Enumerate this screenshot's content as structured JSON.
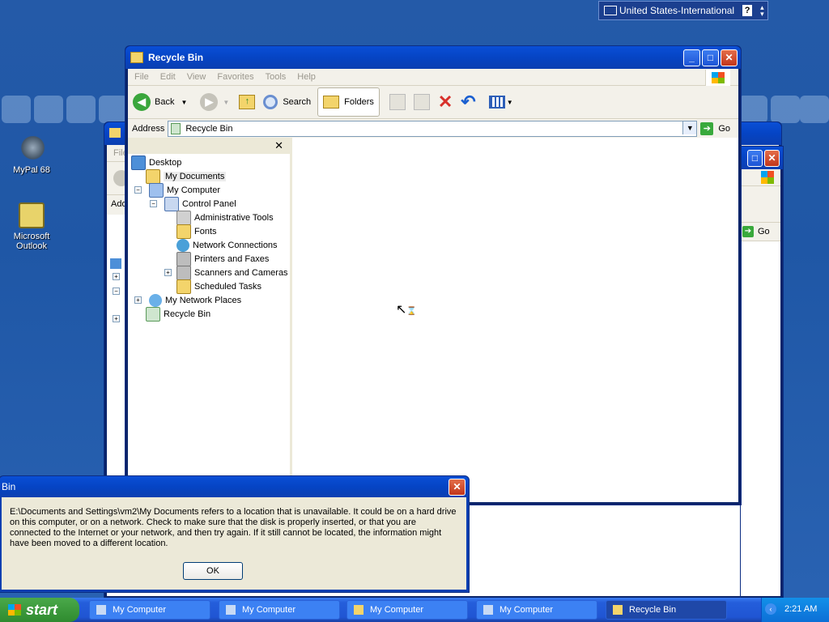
{
  "language_bar": {
    "label": "United States-International"
  },
  "desktop_icons": [
    {
      "label": "MyPal 68"
    },
    {
      "label": "Microsoft Outlook"
    }
  ],
  "recycle_window": {
    "title": "Recycle Bin",
    "menu": [
      "File",
      "Edit",
      "View",
      "Favorites",
      "Tools",
      "Help"
    ],
    "toolbar": {
      "back": "Back",
      "search": "Search",
      "folders": "Folders"
    },
    "address": {
      "label": "Address",
      "value": "Recycle Bin",
      "go": "Go"
    },
    "tree": [
      {
        "label": "Desktop"
      },
      {
        "label": "My Documents"
      },
      {
        "label": "My Computer"
      },
      {
        "label": "Control Panel"
      },
      {
        "label": "Administrative Tools"
      },
      {
        "label": "Fonts"
      },
      {
        "label": "Network Connections"
      },
      {
        "label": "Printers and Faxes"
      },
      {
        "label": "Scanners and Cameras"
      },
      {
        "label": "Scheduled Tasks"
      },
      {
        "label": "My Network Places"
      },
      {
        "label": "Recycle Bin"
      }
    ]
  },
  "back_window": {
    "file_stub": "File",
    "addr_stub": "Add",
    "go": "Go"
  },
  "dialog": {
    "title": "Bin",
    "message": "E:\\Documents and Settings\\vm2\\My Documents refers to a location that is unavailable. It could be on a hard drive on this computer, or on a network. Check to make sure that the disk is properly inserted, or that you are connected to the Internet or your network, and then try again. If it still cannot be located, the information might have been moved to a different location.",
    "ok": "OK"
  },
  "taskbar": {
    "start": "start",
    "tasks": [
      {
        "label": "My Computer"
      },
      {
        "label": "My Computer"
      },
      {
        "label": "My Computer"
      },
      {
        "label": "My Computer"
      },
      {
        "label": "Recycle Bin"
      }
    ],
    "clock": "2:21 AM"
  }
}
